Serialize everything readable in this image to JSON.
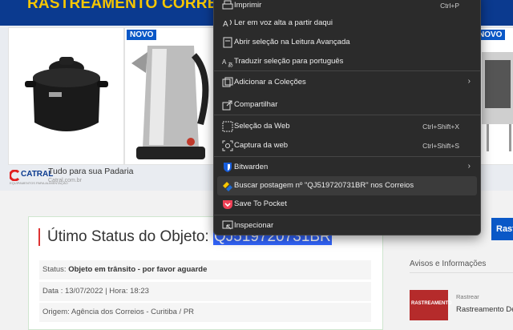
{
  "page": {
    "header_title": "RASTREAMENTO CORREIOS DE",
    "ads": {
      "badge_left": "NOVO",
      "badge_right": "NOVO",
      "logo_text": "CATRAL",
      "logo_sub": "EQUIPAMENTOS PARA ALIMENTAÇÃO",
      "text": "Tudo para sua Padaria",
      "sub": "Catral.com.br"
    },
    "status": {
      "title_prefix": "Útimo Status do Objeto: ",
      "tracking_code": "QJ519720731BR",
      "status_label": "Status: ",
      "status_value": "Objeto em trânsito - por favor aguarde",
      "date_line": "Data : 13/07/2022 | Hora: 18:23",
      "origin_line": "Origem: Agência dos Correios - Curitiba / PR"
    },
    "sidebar": {
      "title": "Avisos e Informações",
      "category": "Rastrear",
      "post_title": "Rastreamento De",
      "thumb_text": "RASTREAMENTO",
      "search_button": "Rastr"
    }
  },
  "context_menu": {
    "items": [
      {
        "label": "Imprimir",
        "shortcut": "Ctrl+P",
        "icon": "print-icon"
      },
      {
        "label": "Ler em voz alta a partir daqui",
        "icon": "read-aloud-icon"
      },
      {
        "label": "Abrir seleção na Leitura Avançada",
        "icon": "immersive-reader-icon"
      },
      {
        "label": "Traduzir seleção para português",
        "icon": "translate-icon"
      },
      {
        "label": "Adicionar a Coleções",
        "icon": "collections-icon"
      },
      {
        "label": "Compartilhar",
        "icon": "share-icon"
      },
      {
        "label": "Seleção da Web",
        "shortcut": "Ctrl+Shift+X",
        "icon": "web-select-icon"
      },
      {
        "label": "Captura da web",
        "shortcut": "Ctrl+Shift+S",
        "icon": "web-capture-icon"
      },
      {
        "label": "Bitwarden",
        "icon": "bitwarden-icon"
      },
      {
        "label": "Buscar postagem nº \"QJ519720731BR\" nos Correios",
        "icon": "correios-icon"
      },
      {
        "label": "Save To Pocket",
        "icon": "pocket-icon"
      },
      {
        "label": "Inspecionar",
        "icon": "inspect-icon"
      }
    ]
  }
}
